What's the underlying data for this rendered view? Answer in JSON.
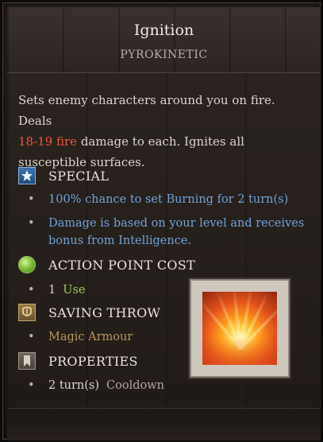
{
  "skill": {
    "name": "Ignition",
    "school": "PYROKINETIC",
    "description": {
      "part1": "Sets enemy characters around you on fire. Deals",
      "damage": "18-19 fire",
      "part2": " damage to each. Ignites all susceptible surfaces."
    }
  },
  "sections": {
    "special": {
      "label": "SPECIAL",
      "icon": "star-icon",
      "items": [
        "100% chance to set Burning for 2 turn(s)",
        "Damage is based on your level and receives bonus from Intelligence."
      ]
    },
    "ap_cost": {
      "label": "ACTION POINT COST",
      "icon": "green-orb-icon",
      "value": "1",
      "unit": "Use"
    },
    "saving_throw": {
      "label": "SAVING THROW",
      "icon": "armour-icon",
      "value": "Magic Armour"
    },
    "properties": {
      "label": "PROPERTIES",
      "icon": "bookmark-icon",
      "value": "2 turn(s)",
      "unit": "Cooldown"
    }
  },
  "colors": {
    "damage": "#e8583a",
    "special_text": "#6fa2d9",
    "ap_text": "#9bcc58",
    "saving_text": "#b7975b"
  },
  "skill_icon": "ignition-skill-icon"
}
